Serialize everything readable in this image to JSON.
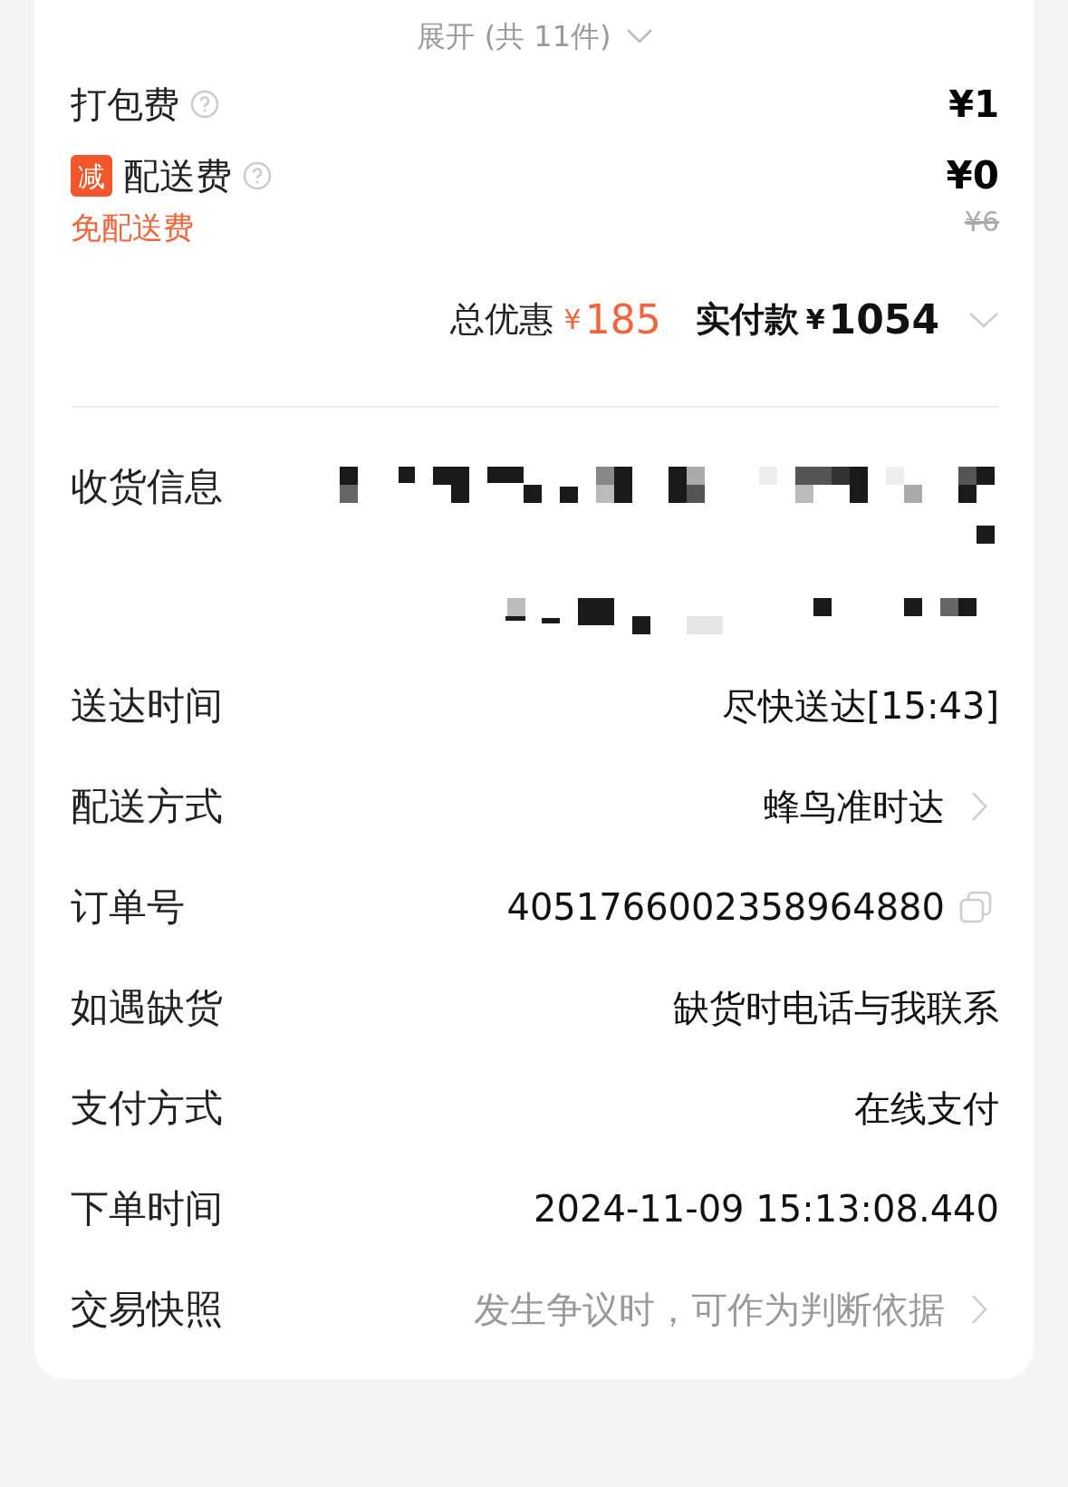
{
  "expand": {
    "label": "展开 (共 11件)"
  },
  "fees": [
    {
      "kind": "packing",
      "label": "打包费",
      "price": "¥1"
    },
    {
      "kind": "delivery",
      "badge": "减",
      "label": "配送费",
      "note": "免配送费",
      "price": "¥0",
      "original_price": "¥6"
    }
  ],
  "summary": {
    "discount_label": "总优惠",
    "discount_currency": "¥",
    "discount_amount": "185",
    "paid_label": "实付款",
    "paid_currency": "¥",
    "paid_amount": "1054"
  },
  "details": [
    {
      "kind": "redacted",
      "label": "收货信息"
    },
    {
      "kind": "text",
      "label": "送达时间",
      "value": "尽快送达[15:43]"
    },
    {
      "kind": "link",
      "label": "配送方式",
      "value": "蜂鸟准时达"
    },
    {
      "kind": "copy",
      "label": "订单号",
      "value": "4051766002358964880"
    },
    {
      "kind": "text",
      "label": "如遇缺货",
      "value": "缺货时电话与我联系"
    },
    {
      "kind": "text",
      "label": "支付方式",
      "value": "在线支付"
    },
    {
      "kind": "text",
      "label": "下单时间",
      "value": "2024-11-09 15:13:08.440"
    },
    {
      "kind": "hint",
      "label": "交易快照",
      "value": "发生争议时，可作为判断依据"
    }
  ]
}
